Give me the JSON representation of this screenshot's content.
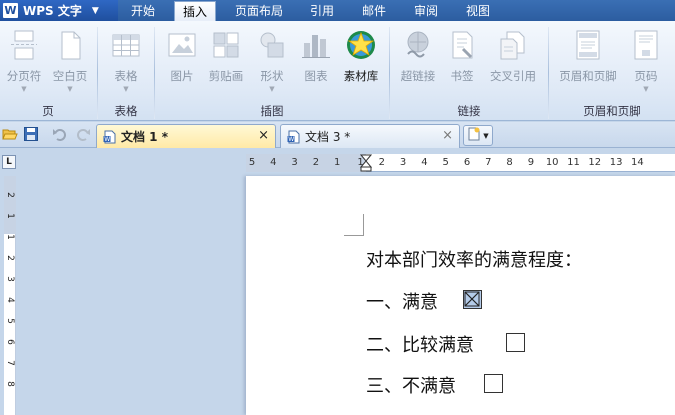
{
  "app": {
    "logo": "WPS 文字",
    "logo_letter": "W"
  },
  "menu_tabs": [
    {
      "label": "开始",
      "active": false
    },
    {
      "label": "插入",
      "active": true
    },
    {
      "label": "页面布局",
      "active": false
    },
    {
      "label": "引用",
      "active": false
    },
    {
      "label": "邮件",
      "active": false
    },
    {
      "label": "审阅",
      "active": false
    },
    {
      "label": "视图",
      "active": false
    }
  ],
  "ribbon": {
    "buttons": [
      {
        "label": "分页符",
        "icon": "page-break-icon",
        "enabled": false
      },
      {
        "label": "空白页",
        "icon": "blank-page-icon",
        "enabled": false
      },
      {
        "label": "表格",
        "icon": "table-icon",
        "enabled": false
      },
      {
        "label": "图片",
        "icon": "picture-icon",
        "enabled": false
      },
      {
        "label": "剪贴画",
        "icon": "clipart-icon",
        "enabled": false
      },
      {
        "label": "形状",
        "icon": "shapes-icon",
        "enabled": false
      },
      {
        "label": "图表",
        "icon": "chart-icon",
        "enabled": false
      },
      {
        "label": "素材库",
        "icon": "material-library-icon",
        "enabled": true
      },
      {
        "label": "超链接",
        "icon": "hyperlink-icon",
        "enabled": false
      },
      {
        "label": "书签",
        "icon": "bookmark-icon",
        "enabled": false
      },
      {
        "label": "交叉引用",
        "icon": "cross-reference-icon",
        "enabled": false
      },
      {
        "label": "页眉和页脚",
        "icon": "header-footer-icon",
        "enabled": false
      },
      {
        "label": "页码",
        "icon": "page-number-icon",
        "enabled": false
      }
    ],
    "groups": [
      "页",
      "表格",
      "插图",
      "链接",
      "页眉和页脚"
    ]
  },
  "doc_tabs": [
    {
      "label": "文档 1 *",
      "active": true
    },
    {
      "label": "文档 3 *",
      "active": false
    }
  ],
  "close_glyph": "×",
  "ruler": {
    "corner": "L",
    "h_numbers": [
      "5",
      "4",
      "3",
      "2",
      "1",
      "1",
      "2",
      "3",
      "4",
      "5",
      "6",
      "7",
      "8",
      "9",
      "10",
      "11",
      "12",
      "13",
      "14"
    ],
    "v_numbers": [
      "2",
      "1",
      "1",
      "2",
      "3",
      "4",
      "5",
      "6",
      "7",
      "8"
    ]
  },
  "document": {
    "lines": [
      {
        "text": "对本部门效率的满意程度：",
        "checkbox": null
      },
      {
        "text": "一、满意",
        "checkbox": "checked"
      },
      {
        "text": "二、比较满意",
        "checkbox": "unchecked"
      },
      {
        "text": "三、不满意",
        "checkbox": "unchecked"
      }
    ]
  },
  "colors": {
    "accent": "#2c5da0",
    "active_tab": "#ffe9a6",
    "selection": "#b4cbe9"
  }
}
